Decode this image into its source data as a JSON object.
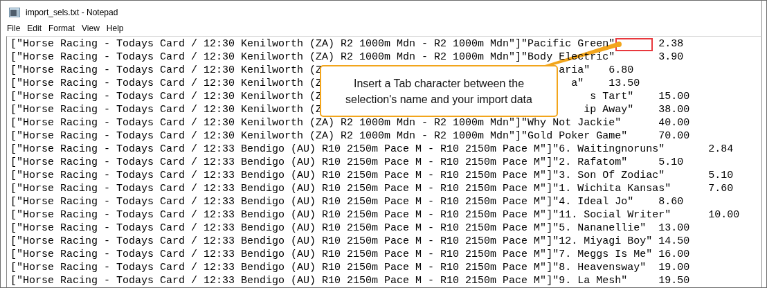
{
  "window": {
    "title": "import_sels.txt - Notepad"
  },
  "menu": [
    "File",
    "Edit",
    "Format",
    "View",
    "Help"
  ],
  "lines": [
    {
      "text": "[\"Horse Racing - Todays Card / 12:30 Kenilworth (ZA) R2 1000m Mdn - R2 1000m Mdn\"]\"Pacific Green\"\t2.38"
    },
    {
      "text": "[\"Horse Racing - Todays Card / 12:30 Kenilworth (ZA) R2 1000m Mdn - R2 1000m Mdn\"]\"Body Electric\"\t3.90"
    },
    {
      "text": "[\"Horse Racing - Todays Card / 12:30 Kenilworth (Z",
      "tail": "aria\"\t6.80"
    },
    {
      "text": "[\"Horse Racing - Todays Card / 12:30 Kenilworth (Z",
      "tail": "a\"\t13.50"
    },
    {
      "text": "[\"Horse Racing - Todays Card / 12:30 Kenilworth (Z",
      "tail": "s Tart\"\t15.00"
    },
    {
      "text": "[\"Horse Racing - Todays Card / 12:30 Kenilworth (Z",
      "tail": "ip Away\"\t38.00"
    },
    {
      "text": "[\"Horse Racing - Todays Card / 12:30 Kenilworth (ZA) R2 1000m Mdn - R2 1000m Mdn\"]\"Why Not Jackie\"\t40.00"
    },
    {
      "text": "[\"Horse Racing - Todays Card / 12:30 Kenilworth (ZA) R2 1000m Mdn - R2 1000m Mdn\"]\"Gold Poker Game\"\t70.00"
    },
    {
      "text": "[\"Horse Racing - Todays Card / 12:33 Bendigo (AU) R10 2150m Pace M - R10 2150m Pace M\"]\"6. Waitingnoruns\"\t2.84"
    },
    {
      "text": "[\"Horse Racing - Todays Card / 12:33 Bendigo (AU) R10 2150m Pace M - R10 2150m Pace M\"]\"2. Rafatom\"\t5.10"
    },
    {
      "text": "[\"Horse Racing - Todays Card / 12:33 Bendigo (AU) R10 2150m Pace M - R10 2150m Pace M\"]\"3. Son Of Zodiac\"\t5.10"
    },
    {
      "text": "[\"Horse Racing - Todays Card / 12:33 Bendigo (AU) R10 2150m Pace M - R10 2150m Pace M\"]\"1. Wichita Kansas\"\t7.60"
    },
    {
      "text": "[\"Horse Racing - Todays Card / 12:33 Bendigo (AU) R10 2150m Pace M - R10 2150m Pace M\"]\"4. Ideal Jo\"\t8.60"
    },
    {
      "text": "[\"Horse Racing - Todays Card / 12:33 Bendigo (AU) R10 2150m Pace M - R10 2150m Pace M\"]\"11. Social Writer\"\t10.00"
    },
    {
      "text": "[\"Horse Racing - Todays Card / 12:33 Bendigo (AU) R10 2150m Pace M - R10 2150m Pace M\"]\"5. Nananellie\"\t13.00"
    },
    {
      "text": "[\"Horse Racing - Todays Card / 12:33 Bendigo (AU) R10 2150m Pace M - R10 2150m Pace M\"]\"12. Miyagi Boy\"\t14.50"
    },
    {
      "text": "[\"Horse Racing - Todays Card / 12:33 Bendigo (AU) R10 2150m Pace M - R10 2150m Pace M\"]\"7. Meggs Is Me\"\t16.00"
    },
    {
      "text": "[\"Horse Racing - Todays Card / 12:33 Bendigo (AU) R10 2150m Pace M - R10 2150m Pace M\"]\"8. Heavensway\"\t19.00"
    },
    {
      "text": "[\"Horse Racing - Todays Card / 12:33 Bendigo (AU) R10 2150m Pace M - R10 2150m Pace M\"]\"9. La Mesh\"\t19.50"
    }
  ],
  "callout": {
    "text": "Insert a Tab character between the selection's name and your import data"
  }
}
